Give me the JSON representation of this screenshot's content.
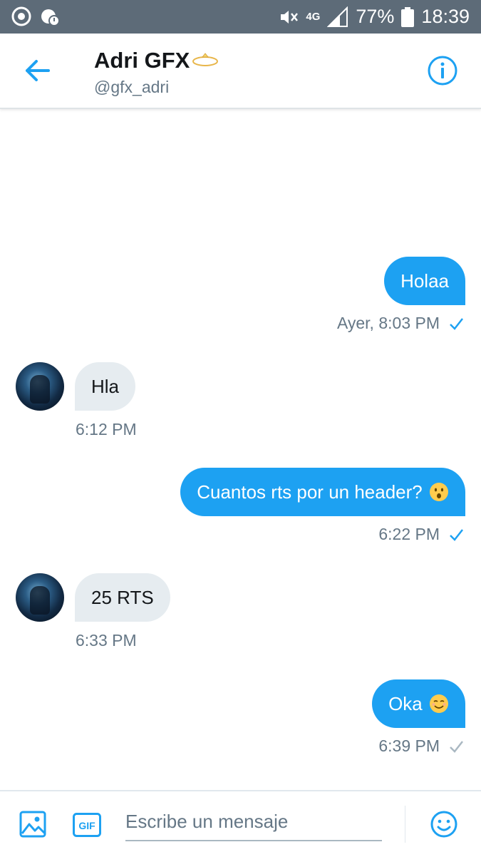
{
  "status_bar": {
    "network": "4G",
    "battery": "77%",
    "time": "18:39",
    "icons": [
      "chrome-icon",
      "notification-icon",
      "mute-icon",
      "signal-icon",
      "battery-icon"
    ]
  },
  "header": {
    "name": "Adri GFX",
    "handle": "@gfx_adri",
    "back_icon": "back-arrow-icon",
    "info_icon": "info-icon"
  },
  "messages": [
    {
      "direction": "out",
      "text": "Holaa",
      "time": "Ayer, 8:03 PM",
      "status": "read"
    },
    {
      "direction": "in",
      "text": "Hla",
      "time": "6:12 PM"
    },
    {
      "direction": "out",
      "text": "Cuantos rts por un header?",
      "emoji": "hushed-face-emoji",
      "time": "6:22 PM",
      "status": "read"
    },
    {
      "direction": "in",
      "text": "25 RTS",
      "time": "6:33 PM"
    },
    {
      "direction": "out",
      "text": "Oka",
      "emoji": "smiling-face-emoji",
      "time": "6:39 PM",
      "status": "sent"
    }
  ],
  "composer": {
    "placeholder": "Escribe un mensaje",
    "gif_label": "GIF"
  },
  "colors": {
    "accent": "#1da1f2",
    "status_bar": "#5d6b78",
    "incoming_bubble": "#e6ecf0",
    "muted_text": "#657786"
  }
}
